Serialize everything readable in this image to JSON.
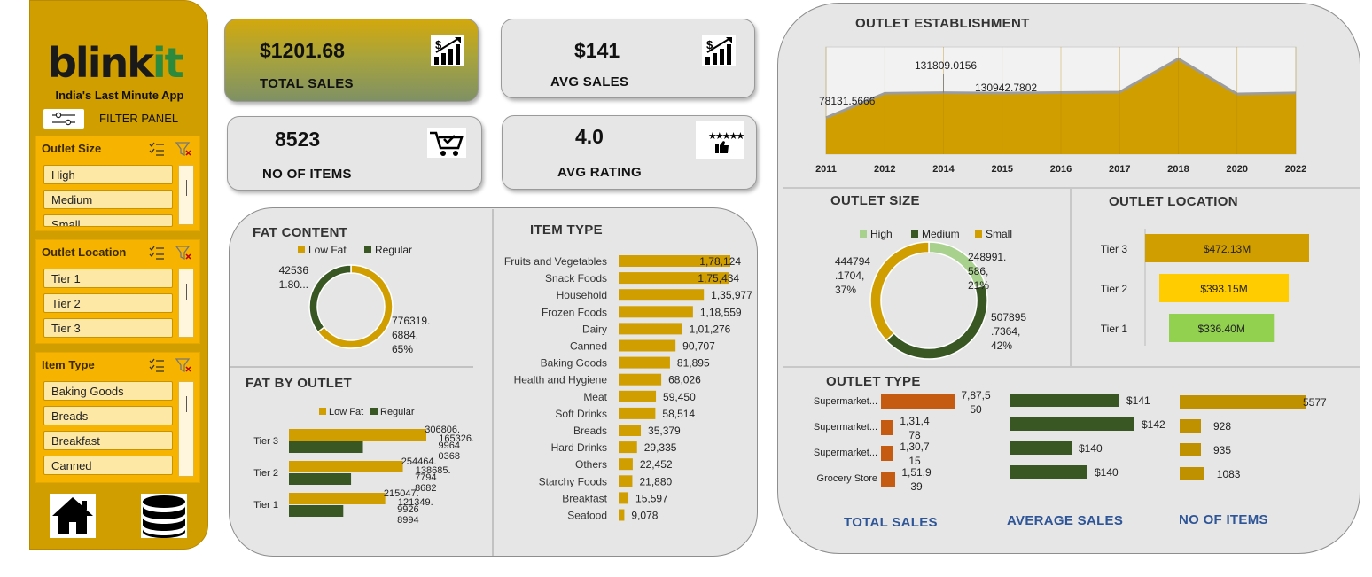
{
  "sidebar": {
    "logo_main": "blink",
    "logo_accent": "it",
    "tagline": "India's Last Minute App",
    "filter_panel_label": "FILTER PANEL",
    "slicers": [
      {
        "title": "Outlet Size",
        "items": [
          "High",
          "Medium",
          "Small"
        ]
      },
      {
        "title": "Outlet Location",
        "items": [
          "Tier 1",
          "Tier 2",
          "Tier 3"
        ]
      },
      {
        "title": "Item Type",
        "items": [
          "Baking Goods",
          "Breads",
          "Breakfast",
          "Canned"
        ]
      }
    ],
    "nav_icons": [
      "home-icon",
      "database-icon"
    ]
  },
  "kpis": {
    "total_sales": {
      "value": "$1201.68",
      "label": "TOTAL SALES",
      "icon": "sales-growth-icon"
    },
    "avg_sales": {
      "value": "$141",
      "label": "AVG SALES",
      "icon": "sales-growth-icon"
    },
    "no_items": {
      "value": "8523",
      "label": "NO OF ITEMS",
      "icon": "cart-icon"
    },
    "avg_rating": {
      "value": "4.0",
      "label": "AVG RATING",
      "icon": "rating-icon"
    }
  },
  "titles": {
    "fat_content": "FAT CONTENT",
    "fat_by_outlet": "FAT BY OUTLET",
    "item_type": "ITEM TYPE",
    "outlet_establishment": "OUTLET ESTABLISHMENT",
    "outlet_size": "OUTLET SIZE",
    "outlet_location": "OUTLET LOCATION",
    "outlet_type": "OUTLET TYPE",
    "total_sales": "TOTAL SALES",
    "average_sales": "AVERAGE SALES",
    "no_of_items": "NO OF ITEMS"
  },
  "colors": {
    "gold": "#d19e00",
    "dark_green": "#385723",
    "light_green": "#a9d18e",
    "yellow": "#ffcc00",
    "lime": "#92d050",
    "orange": "#c55a11",
    "blue_title": "#2e5597"
  },
  "chart_data": [
    {
      "id": "fat_content",
      "type": "pie",
      "labels": [
        "Low Fat",
        "Regular"
      ],
      "values": [
        776319.6884,
        425361.8
      ],
      "data_labels": [
        [
          "776319.",
          "6884,",
          "65%"
        ],
        [
          "42536",
          "1.80..."
        ]
      ],
      "colors": [
        "#d19e00",
        "#385723"
      ],
      "legend": "top"
    },
    {
      "id": "fat_by_outlet",
      "type": "bar",
      "categories": [
        "Tier 3",
        "Tier 2",
        "Tier 1"
      ],
      "series": [
        {
          "name": "Low Fat",
          "values": [
            306806,
            254464,
            215047
          ],
          "labels": [
            "306806.",
            "254464.",
            "215047."
          ]
        },
        {
          "name": "Regular",
          "values": [
            165326,
            138685,
            121349
          ],
          "labels": [
            "165326.",
            "138685.",
            "121349."
          ]
        }
      ],
      "extra_labels": [
        [
          "9964",
          "0368"
        ],
        [
          "7794",
          "8682"
        ],
        [
          "9926",
          "8994"
        ]
      ],
      "legend": "top"
    },
    {
      "id": "item_type",
      "type": "bar",
      "categories": [
        "Fruits and Vegetables",
        "Snack Foods",
        "Household",
        "Frozen Foods",
        "Dairy",
        "Canned",
        "Baking Goods",
        "Health and Hygiene",
        "Meat",
        "Soft Drinks",
        "Breads",
        "Hard Drinks",
        "Others",
        "Starchy Foods",
        "Breakfast",
        "Seafood"
      ],
      "values": [
        178124,
        175434,
        135977,
        118559,
        101276,
        90707,
        81895,
        68026,
        59450,
        58514,
        35379,
        29335,
        22452,
        21880,
        15597,
        9078
      ],
      "labels": [
        "1,78,124",
        "1,75,434",
        "1,35,977",
        "1,18,559",
        "1,01,276",
        "90,707",
        "81,895",
        "68,026",
        "59,450",
        "58,514",
        "35,379",
        "29,335",
        "22,452",
        "21,880",
        "15,597",
        "9,078"
      ]
    },
    {
      "id": "outlet_establishment",
      "type": "area",
      "x": [
        "2011",
        "2012",
        "2014",
        "2015",
        "2016",
        "2017",
        "2018",
        "2020",
        "2022"
      ],
      "values": [
        78131.5666,
        130476.86,
        131809.0156,
        130942.7802,
        132113.37,
        133103.91,
        204522.26,
        129103.96,
        131477.78
      ],
      "data_labels": {
        "0": "78131.5666",
        "2": "131809.0156",
        "3": "130942.7802"
      },
      "ylim": [
        0,
        230000
      ]
    },
    {
      "id": "outlet_size",
      "type": "pie",
      "labels": [
        "High",
        "Medium",
        "Small"
      ],
      "values": [
        248991.586,
        507895.7364,
        444794.1704
      ],
      "data_labels": [
        [
          "248991.",
          "586,",
          "21%"
        ],
        [
          "507895",
          ".7364,",
          "42%"
        ],
        [
          "444794",
          ".1704,",
          "37%"
        ]
      ],
      "colors": [
        "#a9d18e",
        "#385723",
        "#d19e00"
      ],
      "legend": "top"
    },
    {
      "id": "outlet_location",
      "type": "bar",
      "categories": [
        "Tier 3",
        "Tier 2",
        "Tier 1"
      ],
      "values": [
        472.13,
        393.15,
        336.4
      ],
      "labels": [
        "$472.13M",
        "$393.15M",
        "$336.40M"
      ],
      "colors": [
        "#d19e00",
        "#ffcc00",
        "#92d050"
      ],
      "unit": "M"
    },
    {
      "id": "outlet_type_total_sales",
      "type": "bar",
      "categories": [
        "Supermarket...",
        "Supermarket...",
        "Supermarket...",
        "Grocery Store"
      ],
      "values": [
        787550,
        131478,
        130715,
        151939
      ],
      "labels": [
        [
          "7,87,5",
          "50"
        ],
        [
          "1,31,4",
          "78"
        ],
        [
          "1,30,7",
          "15"
        ],
        [
          "1,51,9",
          "39"
        ]
      ]
    },
    {
      "id": "outlet_type_avg_sales",
      "type": "bar",
      "values": [
        141,
        142,
        140,
        140
      ],
      "labels": [
        "$141",
        "$142",
        "$140",
        "$140"
      ]
    },
    {
      "id": "outlet_type_items",
      "type": "bar",
      "values": [
        5577,
        928,
        935,
        1083
      ],
      "labels": [
        "5577",
        "928",
        "935",
        "1083"
      ]
    }
  ]
}
